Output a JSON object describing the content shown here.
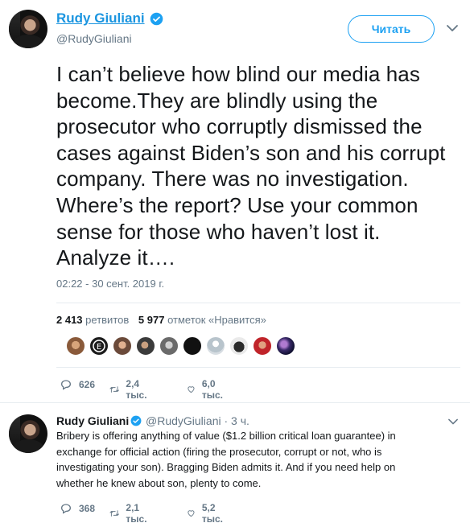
{
  "main_tweet": {
    "author_name": "Rudy Giuliani",
    "handle": "@RudyGiuliani",
    "follow_label": "Читать",
    "text_lines": [
      "I can’t believe how blind our media has",
      "become.They are blindly using the",
      "prosecutor who corruptly dismissed the",
      "cases against Biden’s son and his corrupt",
      "company. There was no investigation.",
      "Where’s the report? Use your common",
      "sense for those who haven’t lost it.",
      "Analyze it…."
    ],
    "timestamp": "02:22 - 30 сент. 2019 г.",
    "retweets_count": "2 413",
    "retweets_label": "ретвитов",
    "likes_count": "5 977",
    "likes_label": "отметок «Нравится»",
    "reply_count": "626",
    "retweet_count_short": "2,4 тыс.",
    "like_count_short": "6,0 тыс."
  },
  "reply_tweet": {
    "author_name": "Rudy Giuliani",
    "handle_time": "@RudyGiuliani · 3 ч.",
    "text_lines": [
      "Bribery is offering anything of value ($1.2 billion critical loan guarantee) in",
      "exchange for official action (firing the prosecutor, corrupt or not, who is",
      "investigating your son). Bragging Biden admits it. And if you need help on",
      "whether he knew about son, plenty to come."
    ],
    "reply_count": "368",
    "retweet_count": "2,1 тыс.",
    "like_count": "5,2 тыс."
  },
  "colors": {
    "brand_blue": "#1da1f2",
    "link_blue": "#1b95e0",
    "muted": "#657786",
    "text": "#14171a"
  }
}
